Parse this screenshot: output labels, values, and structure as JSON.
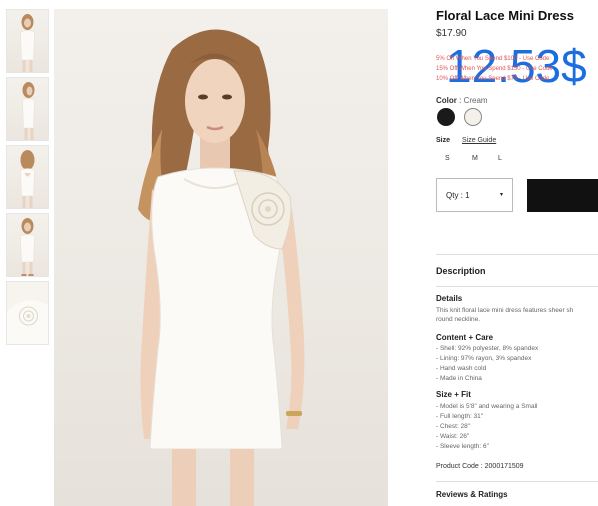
{
  "product": {
    "title": "Floral Lace Mini Dress",
    "price": "$17.90",
    "overlay_price": "12.53$",
    "promos": [
      "5% Off When You Spend $100 - Use Code",
      "15% Off When You Spend $150 - Use Code",
      "10% Off When You Spend $75 - Use Code"
    ]
  },
  "color": {
    "label": "Color",
    "separator": " : ",
    "value": "Cream",
    "swatches": [
      "#1a1a1a",
      "#f4f1ea"
    ]
  },
  "size": {
    "label": "Size",
    "guide": "Size Guide",
    "options": [
      "S",
      "M",
      "L"
    ]
  },
  "qty": {
    "label": "Qty : 1",
    "caret": "▾"
  },
  "description": {
    "heading": "Description",
    "details_heading": "Details",
    "details_text": [
      "This knit floral lace mini dress features sheer sh",
      "round neckline."
    ],
    "care_heading": "Content + Care",
    "care_items": [
      "- Shell: 92% polyester, 8% spandex",
      "- Lining: 97% rayon, 3% spandex",
      "- Hand wash cold",
      "- Made in China"
    ],
    "fit_heading": "Size + Fit",
    "fit_items": [
      "- Model is 5'8\" and wearing a Small",
      "- Full length: 31\"",
      "- Chest: 28\"",
      "- Waist: 26\"",
      "- Sleeve length: 6\""
    ],
    "product_code": "Product Code : 2000171509"
  },
  "reviews_label": "Reviews & Ratings",
  "colors": {
    "promo_red": "#e05353",
    "overlay_blue": "#1a6ee0",
    "button_black": "#111111"
  }
}
